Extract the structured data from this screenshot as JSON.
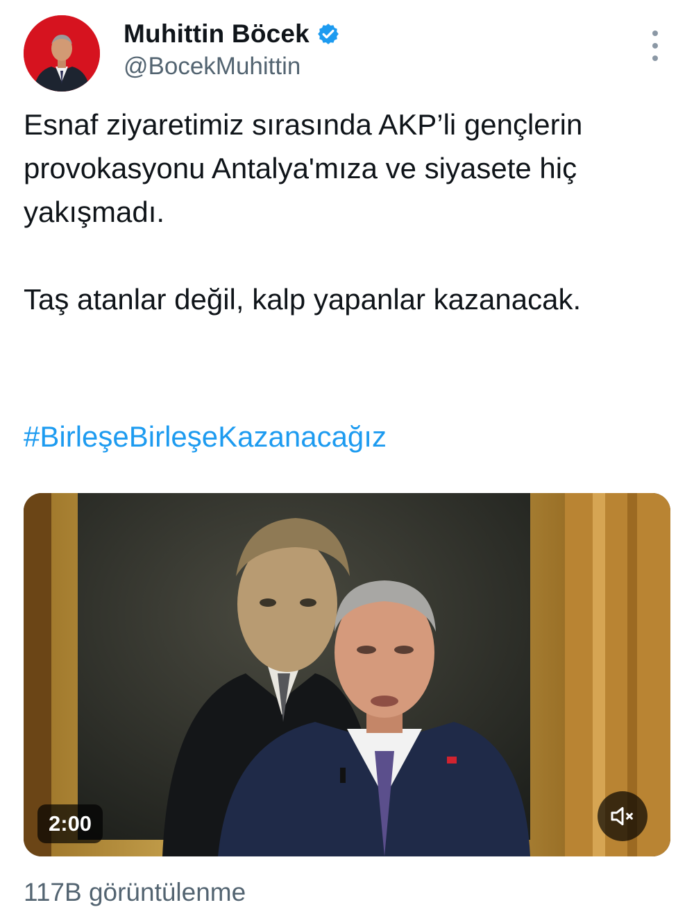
{
  "author": {
    "display_name": "Muhittin Böcek",
    "handle": "@BocekMuhittin",
    "verified": true,
    "avatar_icon": "profile-photo"
  },
  "tweet": {
    "paragraphs": [
      "Esnaf ziyaretimiz sırasında AKP’li gençlerin provokasyonu Antalya'mıza ve siyasete hiç yakışmadı.",
      "Taş atanlar değil, kalp yapanlar kazanacak."
    ],
    "hashtag": "#BirleşeBirleşeKazanacağız"
  },
  "video": {
    "duration": "2:00",
    "muted": true,
    "mute_icon": "volume-muted-icon"
  },
  "stats": {
    "views_label": "117B görüntülenme"
  },
  "colors": {
    "link": "#1d9bf0",
    "secondary_text": "#536471",
    "avatar_bg": "#d6131f"
  }
}
